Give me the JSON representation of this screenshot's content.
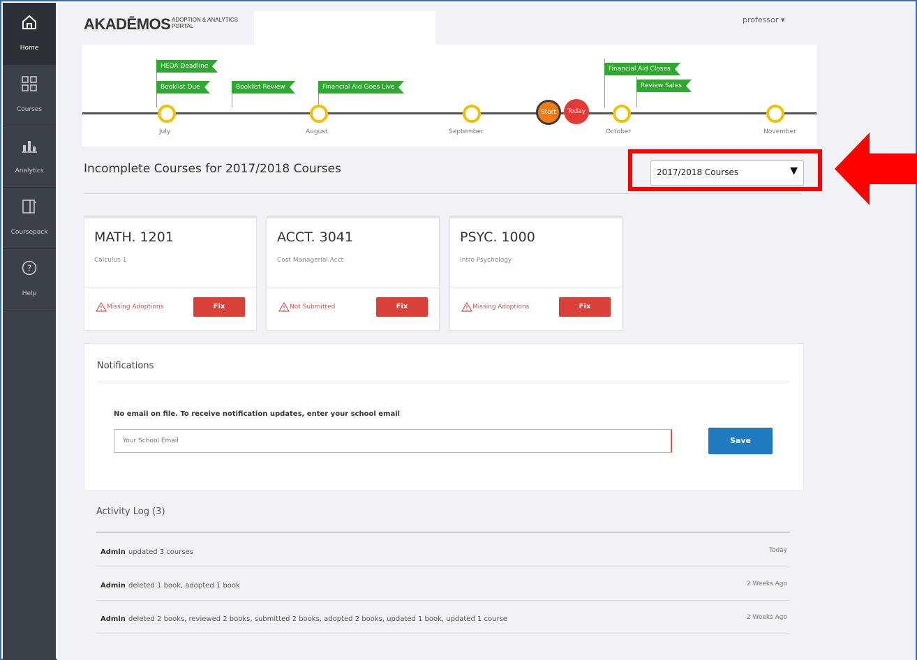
{
  "app": {
    "logo_main": "AKADĒMOS",
    "logo_sub": "ADOPTION & ANALYTICS PORTAL",
    "user_menu": "professor ▾"
  },
  "sidebar": {
    "items": [
      {
        "label": "Home",
        "icon": "home-icon",
        "active": true
      },
      {
        "label": "Courses",
        "icon": "courses-grid-icon",
        "active": false
      },
      {
        "label": "Analytics",
        "icon": "analytics-icon",
        "active": false
      },
      {
        "label": "Coursepack",
        "icon": "book-icon",
        "active": false
      },
      {
        "label": "Help",
        "icon": "help-icon",
        "active": false
      }
    ]
  },
  "timeline": {
    "flags": [
      "HEOA Deadline",
      "Booklist Due",
      "Booklist Review",
      "Financial Aid Goes Live",
      "Financial Aid Closes",
      "Review Sales"
    ],
    "months": [
      "July",
      "August",
      "September",
      "October",
      "November"
    ],
    "start_label": "Start",
    "today_label": "Today"
  },
  "heading": {
    "title": "Incomplete Courses for 2017/2018 Courses",
    "term_selected": "2017/2018 Courses",
    "term_caret": "▼"
  },
  "courses": [
    {
      "code": "MATH. 1201",
      "name": "Calculus 1",
      "status": "Missing Adoptions",
      "fix_label": "Fix"
    },
    {
      "code": "ACCT. 3041",
      "name": "Cost Managerial Acct",
      "status": "Not Submitted",
      "fix_label": "Fix"
    },
    {
      "code": "PSYC. 1000",
      "name": "Intro Psychology",
      "status": "Missing Adoptions",
      "fix_label": "Fix"
    }
  ],
  "notifications": {
    "title": "Notifications",
    "message": "No email on file. To receive notification updates, enter your school email",
    "email_placeholder": "Your School Email",
    "save_label": "Save"
  },
  "activity": {
    "title": "Activity Log (3)",
    "entries": [
      {
        "actor": "Admin",
        "text": "updated 3 courses",
        "when": "Today"
      },
      {
        "actor": "Admin",
        "text": "deleted 1 book, adopted 1 book",
        "when": "2 Weeks Ago"
      },
      {
        "actor": "Admin",
        "text": "deleted 2 books, reviewed 2 books, submitted 2 books, adopted 2 books, updated 1 book, updated 1 course",
        "when": "2 Weeks Ago"
      }
    ]
  },
  "colors": {
    "sidebar_bg": "#3b4148",
    "timeline_flag": "#2ea82e",
    "timeline_dot": "#f2c200",
    "fix_button": "#d9403a",
    "save_button": "#1f7abf",
    "highlight": "#ff0000"
  }
}
